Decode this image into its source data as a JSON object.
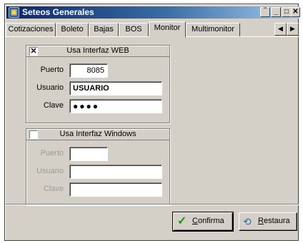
{
  "window": {
    "title": "Seteos Generales"
  },
  "titlebar_buttons": {
    "minimize": "‾",
    "restore": "_",
    "maximize": "□",
    "close": "✕"
  },
  "tabs": [
    {
      "label": "Cotizaciones"
    },
    {
      "label": "Boleto"
    },
    {
      "label": "Bajas"
    },
    {
      "label": "BOS"
    },
    {
      "label": "Monitor",
      "active": true
    },
    {
      "label": "Multimonitor"
    }
  ],
  "tab_scroll": {
    "left": "◀",
    "right": "▶"
  },
  "web_group": {
    "checkbox_mark": "✕",
    "title": "Usa Interfaz WEB",
    "puerto_label": "Puerto",
    "puerto_value": "8085",
    "usuario_label": "Usuario",
    "usuario_value": "USUARIO",
    "clave_label": "Clave",
    "clave_value": "●●●●"
  },
  "windows_group": {
    "checkbox_mark": "",
    "title": "Usa Interfaz Windows",
    "puerto_label": "Puerto",
    "puerto_value": "",
    "usuario_label": "Usuario",
    "usuario_value": "",
    "clave_label": "Clave",
    "clave_value": ""
  },
  "buttons": {
    "confirm_underlined": "C",
    "confirm_rest": "onfirma",
    "restore_underlined": "R",
    "restore_rest": "estaura"
  }
}
